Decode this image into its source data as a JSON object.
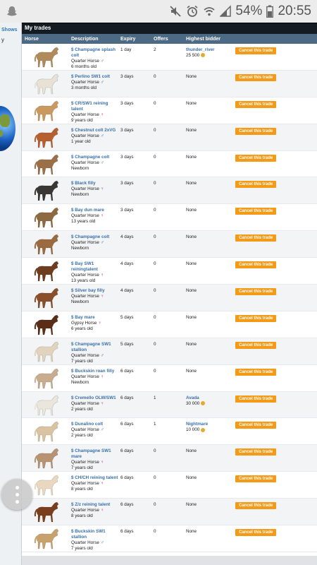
{
  "status_bar": {
    "battery": "54%",
    "time": "20:55",
    "icons": [
      "snapchat-icon",
      "mute-icon",
      "alarm-icon",
      "wifi-icon",
      "signal-icon",
      "battery-icon"
    ]
  },
  "sidebar": {
    "shows_label": "Shows",
    "y_label": "y"
  },
  "panel": {
    "title": "My trades",
    "columns": {
      "horse": "Horse",
      "description": "Description",
      "expiry": "Expiry",
      "offers": "Offers",
      "bidder": "Highest bidder"
    }
  },
  "trades": [
    {
      "name": "$ Champagne splash colt",
      "breed": "Quarter Horse",
      "gender": "male",
      "age": "6 months old",
      "expiry": "1 day",
      "offers": "2",
      "bidder": "thunder_river",
      "amount": "25 500",
      "coat": "#b08a5a",
      "action": "Cancel this trade"
    },
    {
      "name": "$ Perlino SW1 colt",
      "breed": "Quarter Horse",
      "gender": "male",
      "age": "3 months old",
      "expiry": "3 days",
      "offers": "0",
      "bidder": "None",
      "amount": "",
      "coat": "#e7e1d6",
      "action": "Cancel this trade"
    },
    {
      "name": "$ CR/SW1 reining talent",
      "breed": "Quarter Horse",
      "gender": "female",
      "age": "9 years old",
      "expiry": "3 days",
      "offers": "0",
      "bidder": "None",
      "amount": "",
      "coat": "#c9995f",
      "action": "Cancel this trade"
    },
    {
      "name": "$ Chestnut colt 2xVG",
      "breed": "Quarter Horse",
      "gender": "male",
      "age": "1 year old",
      "expiry": "3 days",
      "offers": "0",
      "bidder": "None",
      "amount": "",
      "coat": "#b6602f",
      "action": "Cancel this trade"
    },
    {
      "name": "$ Champagne colt",
      "breed": "Quarter Horse",
      "gender": "male",
      "age": "Newborn",
      "expiry": "3 days",
      "offers": "0",
      "bidder": "None",
      "amount": "",
      "coat": "#9c7047",
      "action": "Cancel this trade"
    },
    {
      "name": "$ Black filly",
      "breed": "Quarter Horse",
      "gender": "female",
      "age": "Newborn",
      "expiry": "3 days",
      "offers": "0",
      "bidder": "None",
      "amount": "",
      "coat": "#3a3633",
      "action": "Cancel this trade"
    },
    {
      "name": "$ Bay dun mare",
      "breed": "Quarter Horse",
      "gender": "female",
      "age": "13 years old",
      "expiry": "3 days",
      "offers": "0",
      "bidder": "None",
      "amount": "",
      "coat": "#8e6a43",
      "action": "Cancel this trade"
    },
    {
      "name": "$ Champagne colt",
      "breed": "Quarter Horse",
      "gender": "male",
      "age": "Newborn",
      "expiry": "4 days",
      "offers": "0",
      "bidder": "None",
      "amount": "",
      "coat": "#9a6b40",
      "action": "Cancel this trade"
    },
    {
      "name": "$ Bay SW1 reiningtalent",
      "breed": "Quarter Horse",
      "gender": "female",
      "age": "13 years old",
      "expiry": "4 days",
      "offers": "0",
      "bidder": "None",
      "amount": "",
      "coat": "#6e3d20",
      "action": "Cancel this trade"
    },
    {
      "name": "$ Silver bay filly",
      "breed": "Quarter Horse",
      "gender": "female",
      "age": "Newborn",
      "expiry": "4 days",
      "offers": "0",
      "bidder": "None",
      "amount": "",
      "coat": "#8a4f2a",
      "action": "Cancel this trade"
    },
    {
      "name": "$ Bay mare",
      "breed": "Gypsy Horse",
      "gender": "female",
      "age": "6 years old",
      "expiry": "5 days",
      "offers": "0",
      "bidder": "None",
      "amount": "",
      "coat": "#5a2e16",
      "action": "Cancel this trade"
    },
    {
      "name": "$ Champagne SW1 stallion",
      "breed": "Quarter Horse",
      "gender": "male",
      "age": "7 years old",
      "expiry": "5 days",
      "offers": "0",
      "bidder": "None",
      "amount": "",
      "coat": "#e2d3bd",
      "action": "Cancel this trade"
    },
    {
      "name": "$ Buckskin roan filly",
      "breed": "Quarter Horse",
      "gender": "female",
      "age": "Newborn",
      "expiry": "6 days",
      "offers": "0",
      "bidder": "None",
      "amount": "",
      "coat": "#c7ad8d",
      "action": "Cancel this trade"
    },
    {
      "name": "$ Cremello OLW/SW1",
      "breed": "Quarter Horse",
      "gender": "female",
      "age": "2 years old",
      "expiry": "6 days",
      "offers": "1",
      "bidder": "Avada",
      "amount": "30 000",
      "coat": "#ebe6dc",
      "action": "Cancel this trade"
    },
    {
      "name": "$ Dunalino colt",
      "breed": "Quarter Horse",
      "gender": "male",
      "age": "2 years old",
      "expiry": "6 days",
      "offers": "1",
      "bidder": "Nightmare",
      "amount": "10 000",
      "coat": "#d9c3a2",
      "action": "Cancel this trade"
    },
    {
      "name": "$ Champagne SW1 mare",
      "breed": "Quarter Horse",
      "gender": "female",
      "age": "7 years old",
      "expiry": "6 days",
      "offers": "0",
      "bidder": "None",
      "amount": "",
      "coat": "#b89372",
      "action": "Cancel this trade"
    },
    {
      "name": "$ CH/CH reining talent",
      "breed": "Quarter Horse",
      "gender": "female",
      "age": "8 years old",
      "expiry": "6 days",
      "offers": "0",
      "bidder": "None",
      "amount": "",
      "coat": "#e9d7bf",
      "action": "Cancel this trade"
    },
    {
      "name": "$ Z/z reining talent",
      "breed": "Quarter Horse",
      "gender": "female",
      "age": "8 years old",
      "expiry": "6 days",
      "offers": "0",
      "bidder": "None",
      "amount": "",
      "coat": "#7a3e1c",
      "action": "Cancel this trade"
    },
    {
      "name": "$ Buckskin SW1 stallion",
      "breed": "Quarter Horse",
      "gender": "male",
      "age": "7 years old",
      "expiry": "6 days",
      "offers": "0",
      "bidder": "None",
      "amount": "",
      "coat": "#c8a26d",
      "action": "Cancel this trade"
    }
  ],
  "colors": {
    "header_bg": "#4d6a84",
    "title_bg": "#151b22",
    "button": "#f49a16",
    "link": "#3a70a8",
    "male": "#2c6fb5",
    "female": "#d23f8b"
  }
}
